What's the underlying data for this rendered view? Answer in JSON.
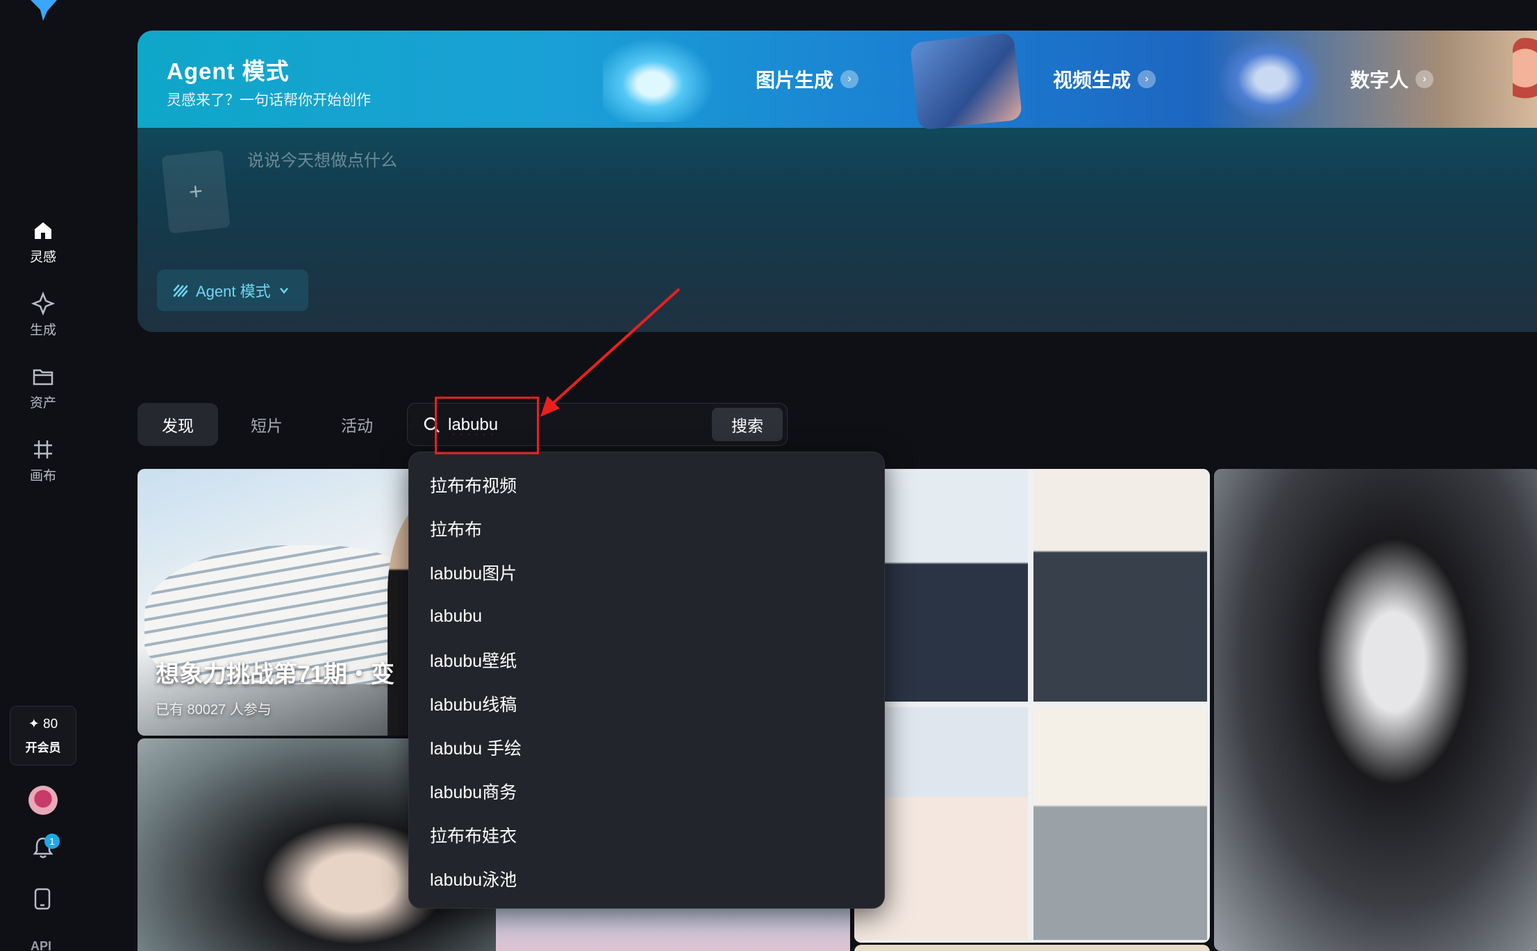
{
  "sidebar": {
    "nav": [
      {
        "label": "灵感",
        "icon": "home-icon"
      },
      {
        "label": "生成",
        "icon": "sparkle-icon"
      },
      {
        "label": "资产",
        "icon": "folder-icon"
      },
      {
        "label": "画布",
        "icon": "canvas-icon"
      }
    ],
    "vip": {
      "credits": "✦ 80",
      "label": "开会员"
    },
    "notification_count": "1",
    "api_label": "API"
  },
  "banner": {
    "title": "Agent 模式",
    "subtitle": "灵感来了？一句话帮你开始创作",
    "features": [
      {
        "label": "图片生成"
      },
      {
        "label": "视频生成"
      },
      {
        "label": "数字人"
      }
    ]
  },
  "prompt": {
    "placeholder": "说说今天想做点什么",
    "upload_symbol": "+",
    "mode_label": "Agent 模式"
  },
  "tabs": [
    {
      "label": "发现",
      "active": true
    },
    {
      "label": "短片",
      "active": false
    },
    {
      "label": "活动",
      "active": false
    }
  ],
  "search": {
    "value": "labubu",
    "button_label": "搜索",
    "suggestions": [
      "拉布布视频",
      "拉布布",
      "labubu图片",
      "labubu",
      "labubu壁纸",
      "labubu线稿",
      "labubu 手绘",
      "labubu商务",
      "拉布布娃衣",
      "labubu泳池"
    ]
  },
  "gallery": {
    "challenge_title": "想象力挑战第71期・变",
    "challenge_participants": "已有 80027 人参与"
  },
  "colors": {
    "background": "#0f1015",
    "accent": "#6fd6f2",
    "annotation_red": "#e82020",
    "badge_blue": "#1ea8e8"
  }
}
